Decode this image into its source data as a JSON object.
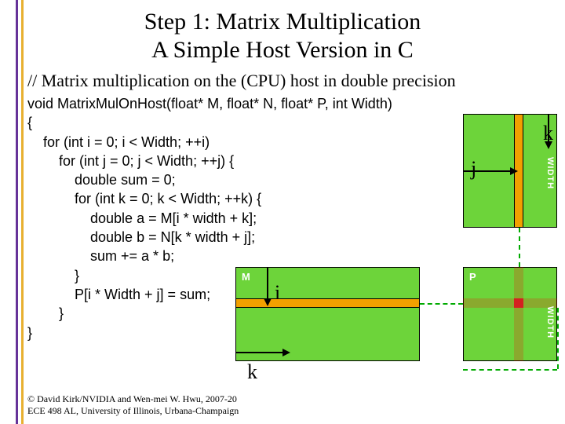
{
  "title_line1": "Step 1: Matrix Multiplication",
  "title_line2": "A Simple Host Version in C",
  "comment": "// Matrix multiplication on the (CPU) host in double precision",
  "code": {
    "l0": "void MatrixMulOnHost(float* M, float* N, float* P, int Width)",
    "l1": "{",
    "l2": "    for (int i = 0; i < Width; ++i)",
    "l3": "        for (int j = 0; j < Width; ++j) {",
    "l4": "            double sum = 0;",
    "l5": "            for (int k = 0; k < Width; ++k) {",
    "l6": "                double a = M[i * width + k];",
    "l7": "                double b = N[k * width + j];",
    "l8": "                sum += a * b;",
    "l9": "            }",
    "l10": "            P[i * Width + j] = sum;",
    "l11": "        }",
    "l12": "}"
  },
  "diagram": {
    "m_label": "M",
    "p_label": "P",
    "width_label": "WIDTH",
    "idx_i": "i",
    "idx_j": "j",
    "idx_k_top": "k",
    "idx_k_bottom": "k"
  },
  "footer": {
    "l1": "© David Kirk/NVIDIA and Wen-mei W. Hwu, 2007-20",
    "l2": "ECE 498 AL, University of Illinois, Urbana-Champaign"
  }
}
